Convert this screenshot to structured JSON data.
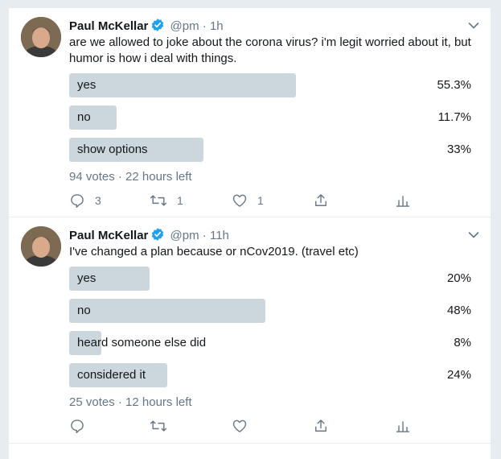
{
  "colors": {
    "accent": "#1da1f2",
    "muted": "#657786",
    "bar": "#ccd6dd"
  },
  "tweets": [
    {
      "author": {
        "name": "Paul McKellar",
        "handle": "@pm",
        "verified_icon": "verified-badge-icon"
      },
      "dot": "·",
      "time": "1h",
      "text": "are we allowed to joke about the corona virus? i'm legit worried about it, but humor is how i deal with things.",
      "poll": {
        "options": [
          {
            "label": "yes",
            "percent": "55.3%",
            "fraction": 0.563
          },
          {
            "label": "no",
            "percent": "11.7%",
            "fraction": 0.117
          },
          {
            "label": "show options",
            "percent": "33%",
            "fraction": 0.334
          }
        ],
        "summary": "94 votes · 22 hours left"
      },
      "actions": {
        "reply": "3",
        "retweet": "1",
        "like": "1"
      }
    },
    {
      "author": {
        "name": "Paul McKellar",
        "handle": "@pm",
        "verified_icon": "verified-badge-icon"
      },
      "dot": "·",
      "time": "11h",
      "text": "I've changed a plan because or nCov2019. (travel etc)",
      "poll": {
        "options": [
          {
            "label": "yes",
            "percent": "20%",
            "fraction": 0.2
          },
          {
            "label": "no",
            "percent": "48%",
            "fraction": 0.488
          },
          {
            "label": "heard someone else did",
            "percent": "8%",
            "fraction": 0.08
          },
          {
            "label": "considered it",
            "percent": "24%",
            "fraction": 0.244
          }
        ],
        "summary": "25 votes · 12 hours left"
      },
      "actions": {
        "reply": "",
        "retweet": "",
        "like": ""
      }
    }
  ]
}
